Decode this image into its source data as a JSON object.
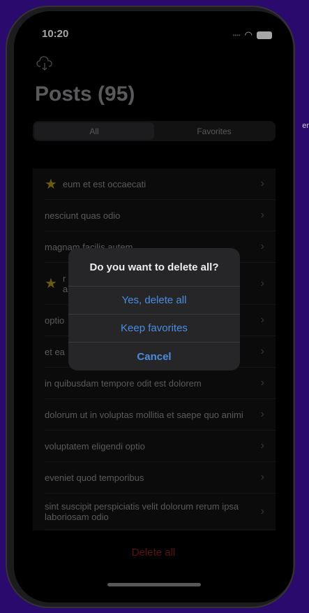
{
  "status": {
    "time": "10:20"
  },
  "header": {
    "title": "Posts (95)",
    "icon": "cloud-download-icon"
  },
  "segments": [
    "All",
    "Favorites"
  ],
  "rows": [
    {
      "text": "eum et est occaecati",
      "favorite": true
    },
    {
      "text": "nesciunt quas odio",
      "favorite": false
    },
    {
      "text": "magnam facilis autem",
      "favorite": false
    },
    {
      "text": "r\na",
      "favorite": true
    },
    {
      "text": "optio",
      "favorite": false
    },
    {
      "text": "et ea",
      "favorite": false
    },
    {
      "text": "in quibusdam tempore odit est dolorem",
      "favorite": false
    },
    {
      "text": "dolorum ut in voluptas mollitia et saepe quo animi",
      "favorite": false
    },
    {
      "text": "voluptatem eligendi optio",
      "favorite": false
    },
    {
      "text": "eveniet quod temporibus",
      "favorite": false
    },
    {
      "text": "sint suscipit perspiciatis velit dolorum rerum ipsa laboriosam odio",
      "favorite": false
    }
  ],
  "footer": {
    "delete_all": "Delete all"
  },
  "alert": {
    "title": "Do you want to delete all?",
    "buttons": [
      "Yes, delete all",
      "Keep favorites",
      "Cancel"
    ]
  },
  "colors": {
    "accent": "#4a8de0",
    "destructive": "#8b1d1d",
    "star": "#a08a1a"
  }
}
